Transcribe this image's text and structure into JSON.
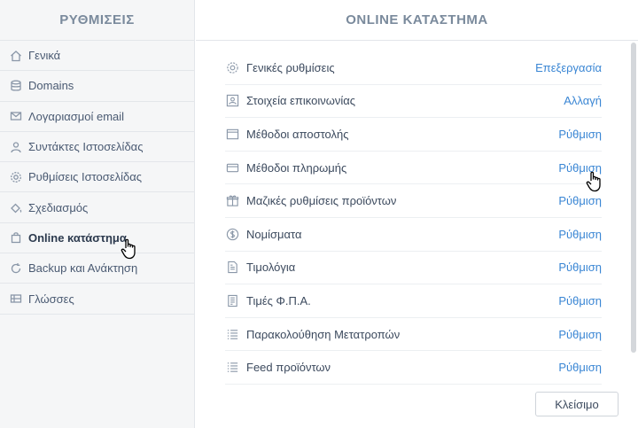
{
  "sidebar": {
    "title": "ΡΥΘΜΙΣΕΙΣ",
    "items": [
      {
        "label": "Γενικά",
        "icon": "home-icon"
      },
      {
        "label": "Domains",
        "icon": "database-icon"
      },
      {
        "label": "Λογαριασμοί email",
        "icon": "envelope-icon"
      },
      {
        "label": "Συντάκτες Ιστοσελίδας",
        "icon": "user-icon"
      },
      {
        "label": "Ρυθμίσεις Ιστοσελίδας",
        "icon": "gear-icon"
      },
      {
        "label": "Σχεδιασμός",
        "icon": "paint-bucket-icon"
      },
      {
        "label": "Online κατάστημα",
        "icon": "shopping-bag-icon"
      },
      {
        "label": "Backup και Ανάκτηση",
        "icon": "refresh-icon"
      },
      {
        "label": "Γλώσσες",
        "icon": "languages-icon"
      }
    ],
    "active_index": 6
  },
  "main": {
    "title": "ONLINE ΚΑΤΑΣΤΗΜΑ",
    "settings": [
      {
        "label": "Γενικές ρυθμίσεις",
        "action": "Επεξεργασία",
        "icon": "gear-icon"
      },
      {
        "label": "Στοιχεία επικοινωνίας",
        "action": "Αλλαγή",
        "icon": "contact-card-icon"
      },
      {
        "label": "Μέθοδοι αποστολής",
        "action": "Ρύθμιση",
        "icon": "box-icon"
      },
      {
        "label": "Μέθοδοι πληρωμής",
        "action": "Ρύθμιση",
        "icon": "credit-card-icon"
      },
      {
        "label": "Μαζικές ρυθμίσεις προϊόντων",
        "action": "Ρύθμιση",
        "icon": "gift-icon"
      },
      {
        "label": "Νομίσματα",
        "action": "Ρύθμιση",
        "icon": "dollar-coin-icon"
      },
      {
        "label": "Τιμολόγια",
        "action": "Ρύθμιση",
        "icon": "invoice-icon"
      },
      {
        "label": "Τιμές Φ.Π.Α.",
        "action": "Ρύθμιση",
        "icon": "receipt-icon"
      },
      {
        "label": "Παρακολούθηση Μετατροπών",
        "action": "Ρύθμιση",
        "icon": "list-icon"
      },
      {
        "label": "Feed προϊόντων",
        "action": "Ρύθμιση",
        "icon": "list-icon"
      }
    ],
    "close_label": "Κλείσιμο"
  },
  "colors": {
    "accent": "#3a86d4",
    "sidebar_bg": "#f5f6f7",
    "heading": "#7a8a9c"
  }
}
